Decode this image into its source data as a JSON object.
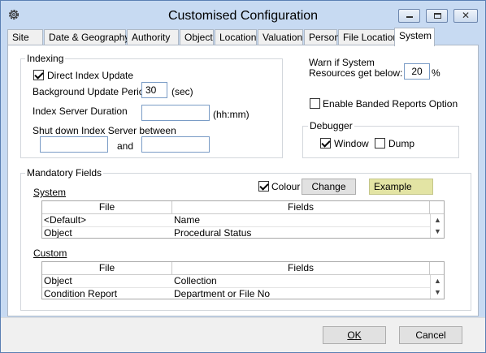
{
  "window": {
    "title": "Customised Configuration"
  },
  "tabs": [
    "Site",
    "Date & Geography",
    "Authority",
    "Object",
    "Location",
    "Valuation",
    "Person",
    "File Locations",
    "System"
  ],
  "indexing": {
    "title": "Indexing",
    "direct_index_update_label": "Direct Index Update",
    "direct_index_update_checked": true,
    "bg_period_label": "Background Update Period",
    "bg_period_value": "30",
    "bg_period_unit": "(sec)",
    "server_duration_label": "Index Server Duration",
    "server_duration_value": "",
    "server_duration_unit": "(hh:mm)",
    "shutdown_label": "Shut down Index Server between",
    "shutdown_from": "",
    "and_label": "and",
    "shutdown_to": ""
  },
  "warn": {
    "label_line1": "Warn if System",
    "label_line2": "Resources get below:",
    "value": "20",
    "unit": "%"
  },
  "banded": {
    "label": "Enable Banded Reports Option",
    "checked": false
  },
  "debugger": {
    "title": "Debugger",
    "window_label": "Window",
    "window_checked": true,
    "dump_label": "Dump",
    "dump_checked": false
  },
  "mandatory": {
    "title": "Mandatory Fields",
    "colour_label": "Colour",
    "colour_checked": true,
    "change_label": "Change",
    "example_label": "Example",
    "example_color": "#e3e4a4",
    "system_label": "System",
    "custom_label": "Custom",
    "columns": [
      "File",
      "Fields"
    ],
    "system_rows": [
      {
        "file": "<Default>",
        "fields": "Name"
      },
      {
        "file": "Object",
        "fields": "Procedural Status"
      }
    ],
    "custom_rows": [
      {
        "file": "Object",
        "fields": "Collection"
      },
      {
        "file": "Condition Report",
        "fields": "Department or File No"
      }
    ]
  },
  "footer": {
    "ok_label": "OK",
    "cancel_label": "Cancel"
  },
  "icons": {
    "app": "gear-icon",
    "minimize": "minimize-icon",
    "maximize": "maximize-icon",
    "close": "close-icon"
  }
}
